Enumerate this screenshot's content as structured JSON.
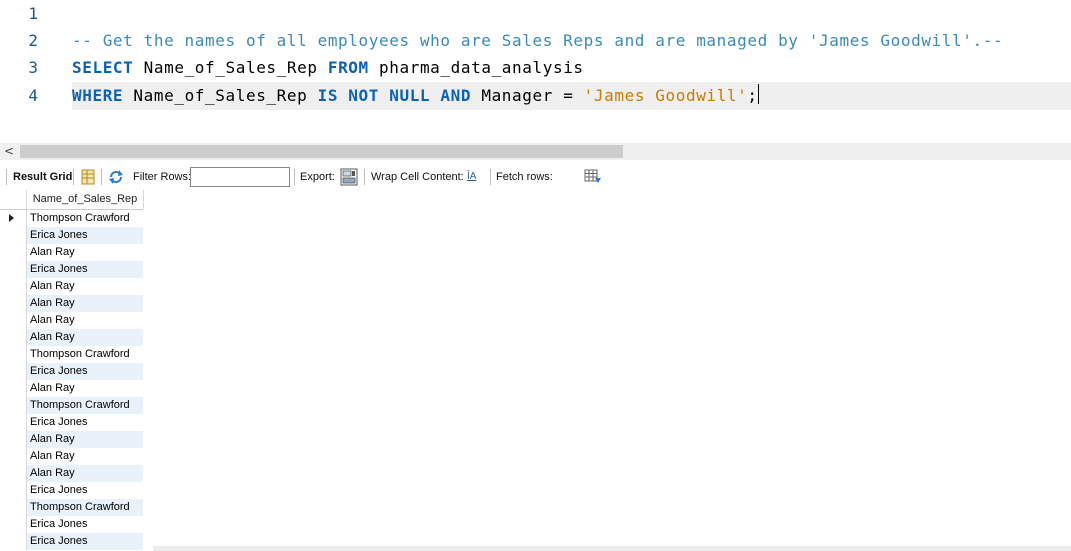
{
  "editor": {
    "lines": [
      {
        "num": "1"
      },
      {
        "num": "2",
        "comment": "-- Get the names of all employees who are Sales Reps and are managed by 'James Goodwill'.--"
      },
      {
        "num": "3",
        "kw1": "SELECT",
        "t1": " Name_of_Sales_Rep ",
        "kw2": "FROM",
        "t2": " pharma_data_analysis"
      },
      {
        "num": "4",
        "kw1": "WHERE",
        "t1": " Name_of_Sales_Rep ",
        "kw2": "IS NOT NULL AND",
        "t2": " Manager = ",
        "str": "'James Goodwill'",
        "t3": ";"
      }
    ]
  },
  "scrollbar": {
    "left_arrow": "<"
  },
  "toolbar": {
    "result_grid": "Result Grid",
    "filter_rows": "Filter Rows:",
    "filter_value": "",
    "export": "Export:",
    "wrap_cell": "Wrap Cell Content:",
    "wrap_icon_text": "ĪA",
    "fetch_rows": "Fetch rows:"
  },
  "grid": {
    "column": "Name_of_Sales_Rep",
    "rows": [
      "Thompson Crawford",
      "Erica Jones",
      "Alan Ray",
      "Erica Jones",
      "Alan Ray",
      "Alan Ray",
      "Alan Ray",
      "Alan Ray",
      "Thompson Crawford",
      "Erica Jones",
      "Alan Ray",
      "Thompson Crawford",
      "Erica Jones",
      "Alan Ray",
      "Alan Ray",
      "Alan Ray",
      "Erica Jones",
      "Thompson Crawford",
      "Erica Jones",
      "Erica Jones"
    ]
  },
  "colors": {
    "keyword": "#0b62b8",
    "comment": "#3d8ab8",
    "string": "#cc7a00",
    "line_number": "#1a5a8a",
    "row_alt": "#e9f1fb"
  }
}
